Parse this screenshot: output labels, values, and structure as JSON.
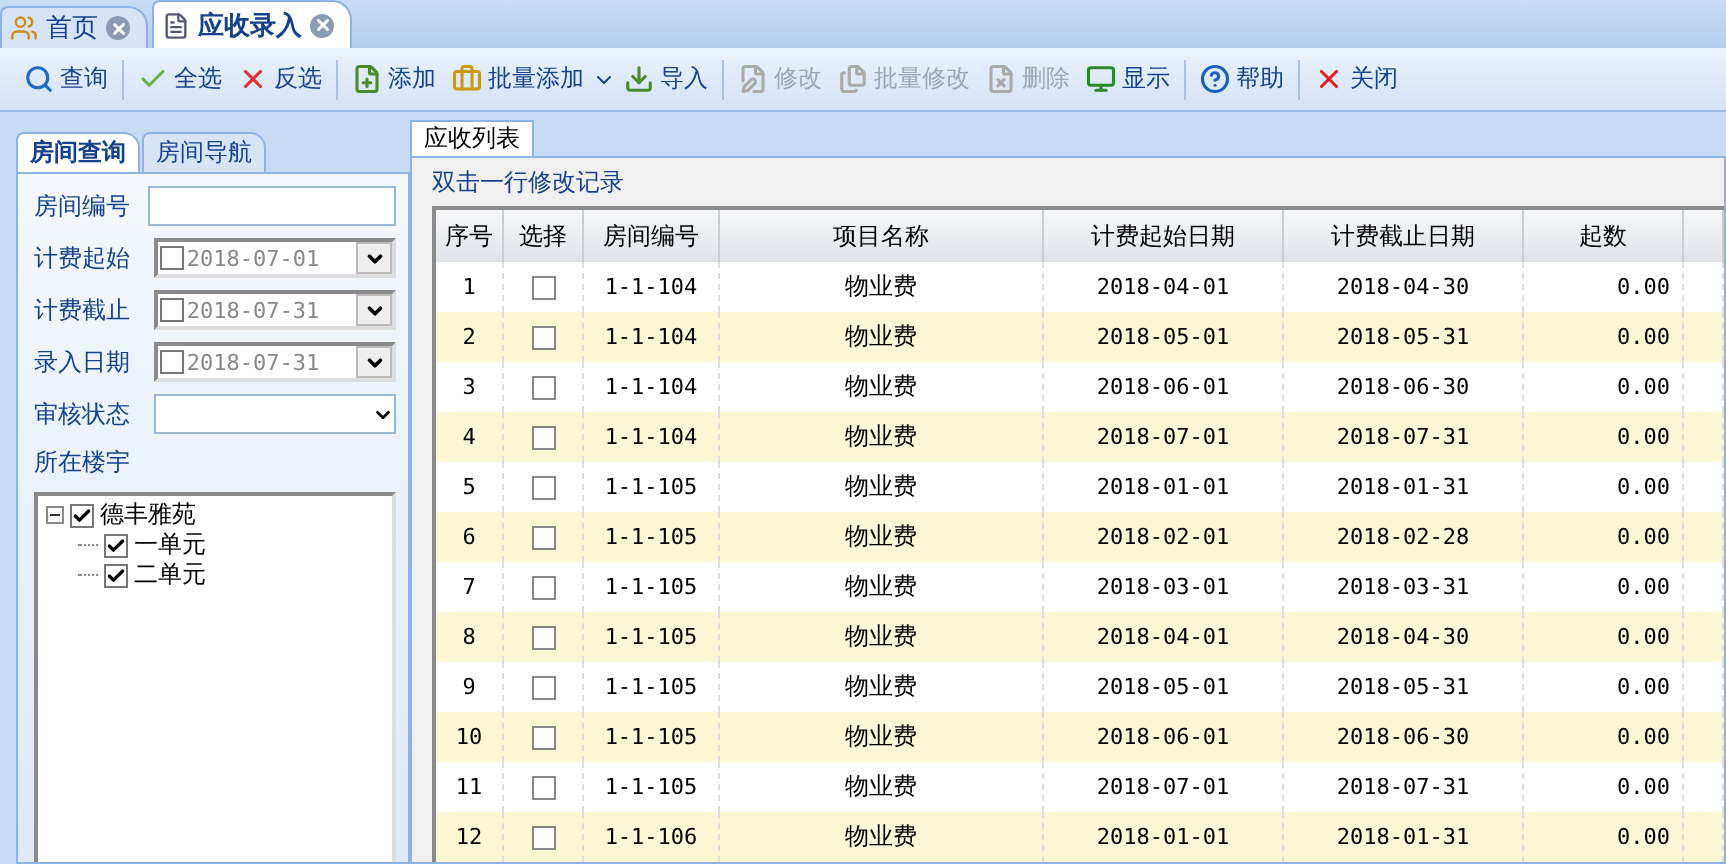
{
  "tabs": [
    {
      "label": "首页",
      "selected": false
    },
    {
      "label": "应收录入",
      "selected": true
    }
  ],
  "toolbar": [
    [
      {
        "label": "查询",
        "disabled": false
      }
    ],
    [
      {
        "label": "全选",
        "disabled": false
      },
      {
        "label": "反选",
        "disabled": false
      }
    ],
    [
      {
        "label": "添加",
        "disabled": false
      },
      {
        "label": "批量添加",
        "disabled": false,
        "menu": true
      },
      {
        "label": "导入",
        "disabled": false
      }
    ],
    [
      {
        "label": "修改",
        "disabled": true
      },
      {
        "label": "批量修改",
        "disabled": true
      },
      {
        "label": "删除",
        "disabled": true
      },
      {
        "label": "显示",
        "disabled": false
      }
    ],
    [
      {
        "label": "帮助",
        "disabled": false
      }
    ],
    [
      {
        "label": "关闭",
        "disabled": false
      }
    ]
  ],
  "side_tabs": [
    {
      "label": "房间查询",
      "selected": true
    },
    {
      "label": "房间导航",
      "selected": false
    }
  ],
  "filters": [
    {
      "label": "房间编号",
      "kind": "text"
    },
    {
      "label": "计费起始",
      "kind": "date",
      "value": "2018-07-01",
      "checked": false
    },
    {
      "label": "计费截止",
      "kind": "date",
      "value": "2018-07-31",
      "checked": false
    },
    {
      "label": "录入日期",
      "kind": "date",
      "value": "2018-07-31",
      "checked": false
    },
    {
      "label": "审核状态",
      "kind": "select"
    }
  ],
  "tree_label": "所在楼宇",
  "tree": [
    {
      "label": "德丰雅苑",
      "checked": true,
      "expanded": true,
      "children": [
        {
          "label": "一单元",
          "checked": true
        },
        {
          "label": "二单元",
          "checked": true
        }
      ]
    }
  ],
  "list_tab": {
    "label": "应收列表",
    "selected": true
  },
  "hint": "双击一行修改记录",
  "table": {
    "columns": [
      "序号",
      "选择",
      "房间编号",
      "项目名称",
      "计费起始日期",
      "计费截止日期",
      "起数"
    ],
    "rows": [
      {
        "cells": [
          "1",
          "",
          "1-1-104",
          "物业费",
          "2018-04-01",
          "2018-04-30",
          "0.00"
        ],
        "checked": false
      },
      {
        "cells": [
          "2",
          "",
          "1-1-104",
          "物业费",
          "2018-05-01",
          "2018-05-31",
          "0.00"
        ],
        "checked": false
      },
      {
        "cells": [
          "3",
          "",
          "1-1-104",
          "物业费",
          "2018-06-01",
          "2018-06-30",
          "0.00"
        ],
        "checked": false
      },
      {
        "cells": [
          "4",
          "",
          "1-1-104",
          "物业费",
          "2018-07-01",
          "2018-07-31",
          "0.00"
        ],
        "checked": false
      },
      {
        "cells": [
          "5",
          "",
          "1-1-105",
          "物业费",
          "2018-01-01",
          "2018-01-31",
          "0.00"
        ],
        "checked": false
      },
      {
        "cells": [
          "6",
          "",
          "1-1-105",
          "物业费",
          "2018-02-01",
          "2018-02-28",
          "0.00"
        ],
        "checked": false
      },
      {
        "cells": [
          "7",
          "",
          "1-1-105",
          "物业费",
          "2018-03-01",
          "2018-03-31",
          "0.00"
        ],
        "checked": false
      },
      {
        "cells": [
          "8",
          "",
          "1-1-105",
          "物业费",
          "2018-04-01",
          "2018-04-30",
          "0.00"
        ],
        "checked": false
      },
      {
        "cells": [
          "9",
          "",
          "1-1-105",
          "物业费",
          "2018-05-01",
          "2018-05-31",
          "0.00"
        ],
        "checked": false
      },
      {
        "cells": [
          "10",
          "",
          "1-1-105",
          "物业费",
          "2018-06-01",
          "2018-06-30",
          "0.00"
        ],
        "checked": false
      },
      {
        "cells": [
          "11",
          "",
          "1-1-105",
          "物业费",
          "2018-07-01",
          "2018-07-31",
          "0.00"
        ],
        "checked": false
      },
      {
        "cells": [
          "12",
          "",
          "1-1-106",
          "物业费",
          "2018-01-01",
          "2018-01-31",
          "0.00"
        ],
        "checked": false
      }
    ]
  }
}
